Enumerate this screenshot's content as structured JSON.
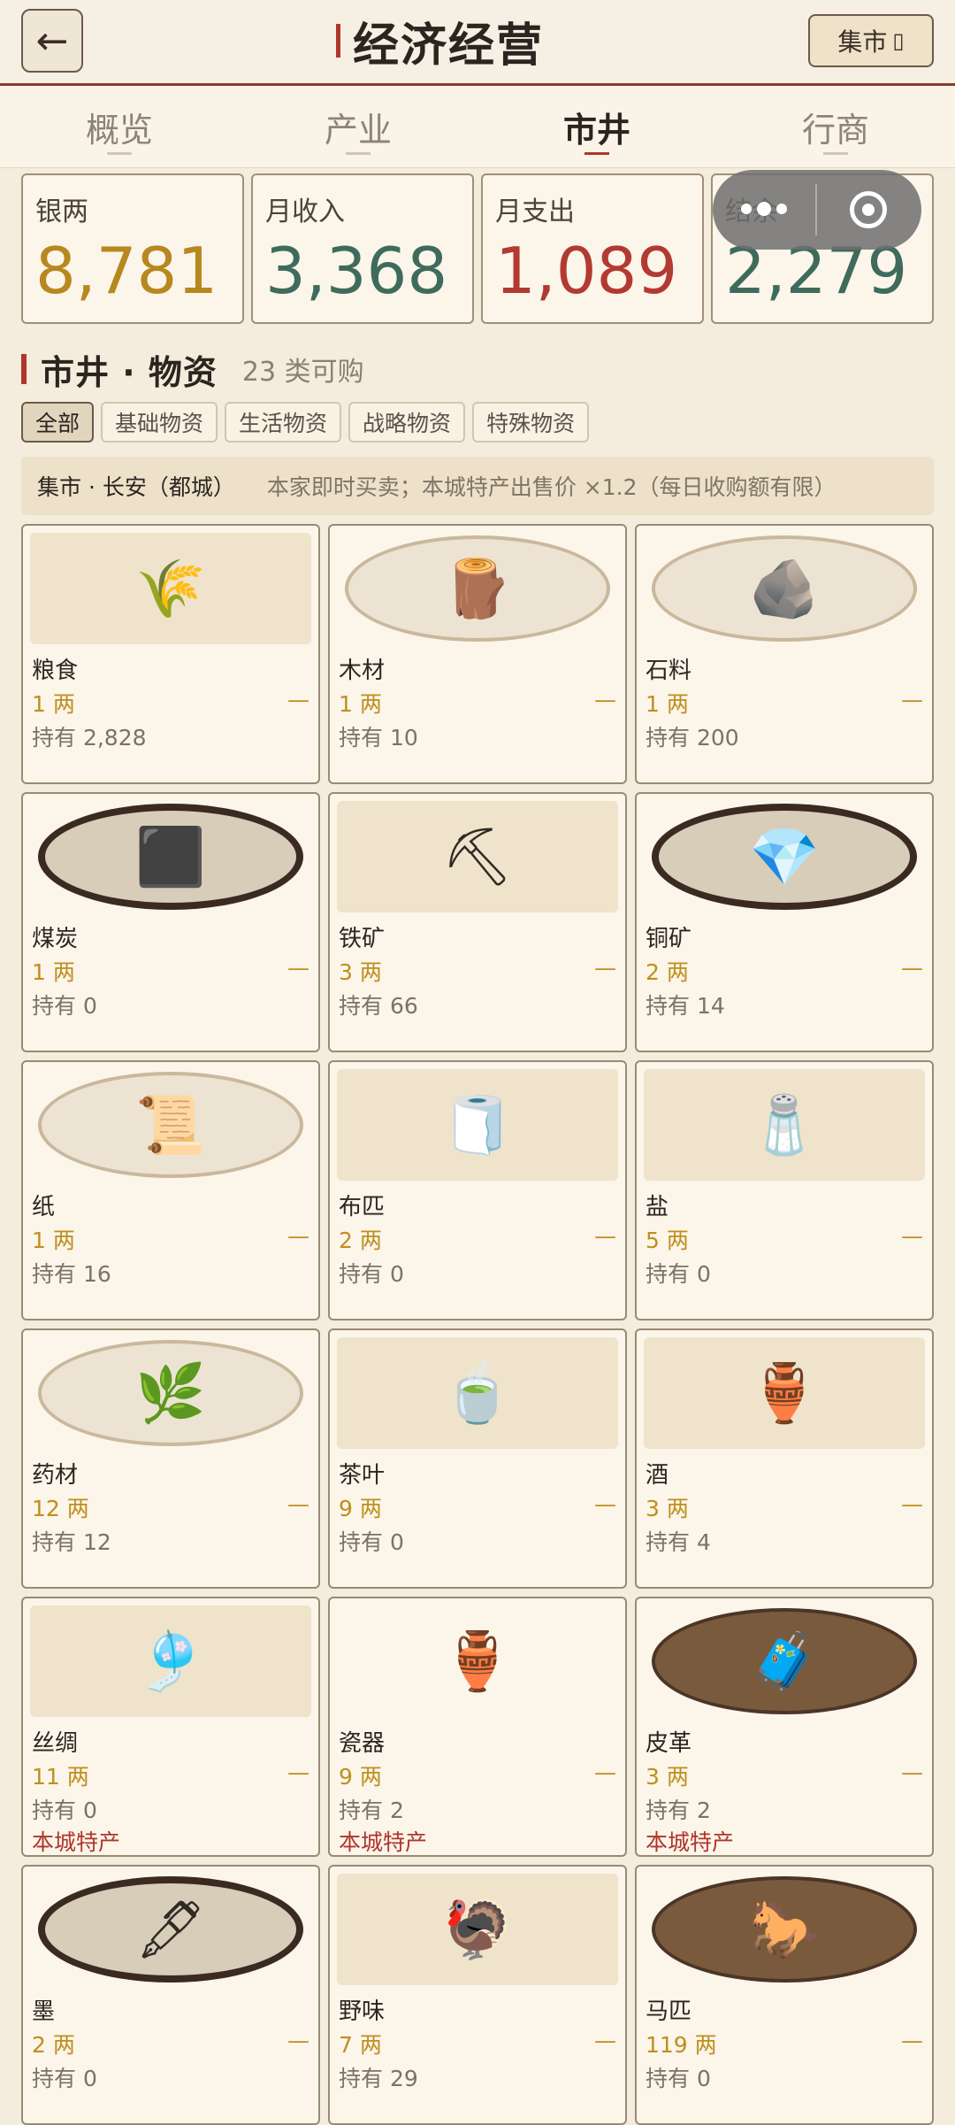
{
  "header": {
    "back_icon": "←",
    "title": "经济经营",
    "market_button": "集市",
    "market_icon": "▯"
  },
  "tabs": [
    {
      "label": "概览",
      "active": false
    },
    {
      "label": "产业",
      "active": false
    },
    {
      "label": "市井",
      "active": true
    },
    {
      "label": "行商",
      "active": false
    }
  ],
  "stats": [
    {
      "label": "银两",
      "value": "8,781",
      "color": "#b7881f"
    },
    {
      "label": "月收入",
      "value": "3,368",
      "color": "#3f6b5c"
    },
    {
      "label": "月支出",
      "value": "1,089",
      "color": "#b23a32"
    },
    {
      "label": "结余",
      "value": "2,279",
      "color": "#3f6b5c"
    }
  ],
  "section": {
    "title": "市井 · 物资",
    "count": "23 类可购"
  },
  "filters": [
    {
      "label": "全部",
      "active": true
    },
    {
      "label": "基础物资",
      "active": false
    },
    {
      "label": "生活物资",
      "active": false
    },
    {
      "label": "战略物资",
      "active": false
    },
    {
      "label": "特殊物资",
      "active": false
    }
  ],
  "banner": {
    "city": "集市 · 长安（都城）",
    "note": "本家即时买卖；本城特产出售价 ×1.2（每日收购额有限）"
  },
  "items": [
    {
      "name": "粮食",
      "price": "1 两",
      "trend": "—",
      "held": "持有 2,828",
      "special": "",
      "icon": "grain-sack-icon",
      "glyph": "🌾",
      "style": "rect"
    },
    {
      "name": "木材",
      "price": "1 两",
      "trend": "—",
      "held": "持有 10",
      "special": "",
      "icon": "wood-bundle-icon",
      "glyph": "🪵",
      "style": "round"
    },
    {
      "name": "石料",
      "price": "1 两",
      "trend": "—",
      "held": "持有 200",
      "special": "",
      "icon": "stone-icon",
      "glyph": "🪨",
      "style": "round"
    },
    {
      "name": "煤炭",
      "price": "1 两",
      "trend": "—",
      "held": "持有 0",
      "special": "",
      "icon": "coal-icon",
      "glyph": "⬛",
      "style": "round-dark"
    },
    {
      "name": "铁矿",
      "price": "3 两",
      "trend": "—",
      "held": "持有 66",
      "special": "",
      "icon": "iron-ore-icon",
      "glyph": "⛏",
      "style": "rect"
    },
    {
      "name": "铜矿",
      "price": "2 两",
      "trend": "—",
      "held": "持有 14",
      "special": "",
      "icon": "copper-ore-icon",
      "glyph": "💎",
      "style": "round-dark"
    },
    {
      "name": "纸",
      "price": "1 两",
      "trend": "—",
      "held": "持有 16",
      "special": "",
      "icon": "paper-icon",
      "glyph": "📜",
      "style": "round"
    },
    {
      "name": "布匹",
      "price": "2 两",
      "trend": "—",
      "held": "持有 0",
      "special": "",
      "icon": "cloth-roll-icon",
      "glyph": "🧻",
      "style": "rect"
    },
    {
      "name": "盐",
      "price": "5 两",
      "trend": "—",
      "held": "持有 0",
      "special": "",
      "icon": "salt-jar-icon",
      "glyph": "🧂",
      "style": "rect"
    },
    {
      "name": "药材",
      "price": "12 两",
      "trend": "—",
      "held": "持有 12",
      "special": "",
      "icon": "herbs-icon",
      "glyph": "🌿",
      "style": "round"
    },
    {
      "name": "茶叶",
      "price": "9 两",
      "trend": "—",
      "held": "持有 0",
      "special": "",
      "icon": "tea-icon",
      "glyph": "🍵",
      "style": "rect"
    },
    {
      "name": "酒",
      "price": "3 两",
      "trend": "—",
      "held": "持有 4",
      "special": "",
      "icon": "wine-jar-icon",
      "glyph": "🏺",
      "style": "rect"
    },
    {
      "name": "丝绸",
      "price": "11 两",
      "trend": "—",
      "held": "持有 0",
      "special": "本城特产",
      "icon": "silk-icon",
      "glyph": "🎐",
      "style": "rect"
    },
    {
      "name": "瓷器",
      "price": "9 两",
      "trend": "—",
      "held": "持有 2",
      "special": "本城特产",
      "icon": "porcelain-vase-icon",
      "glyph": "🏺",
      "style": "plain"
    },
    {
      "name": "皮革",
      "price": "3 两",
      "trend": "—",
      "held": "持有 2",
      "special": "本城特产",
      "icon": "leather-icon",
      "glyph": "🧳",
      "style": "round-brown"
    },
    {
      "name": "墨",
      "price": "2 两",
      "trend": "—",
      "held": "持有 0",
      "special": "",
      "icon": "ink-stone-icon",
      "glyph": "🖋",
      "style": "round-dark"
    },
    {
      "name": "野味",
      "price": "7 两",
      "trend": "—",
      "held": "持有 29",
      "special": "",
      "icon": "game-bird-icon",
      "glyph": "🦃",
      "style": "rect"
    },
    {
      "name": "马匹",
      "price": "119 两",
      "trend": "—",
      "held": "持有 0",
      "special": "",
      "icon": "horse-icon",
      "glyph": "🐎",
      "style": "round-brown"
    }
  ]
}
